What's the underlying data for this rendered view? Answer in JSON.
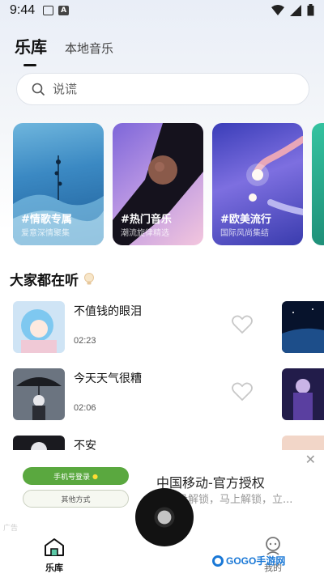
{
  "status_bar": {
    "time": "9:44"
  },
  "tabs": {
    "library": "乐库",
    "local_music": "本地音乐"
  },
  "search": {
    "placeholder": "说谎"
  },
  "categories": [
    {
      "title": "#情歌专属",
      "subtitle": "爱意深情聚集"
    },
    {
      "title": "#热门音乐",
      "subtitle": "潮流旋律精选"
    },
    {
      "title": "#欧美流行",
      "subtitle": "国际风尚集结"
    }
  ],
  "section": {
    "title": "大家都在听"
  },
  "songs": [
    {
      "name": "不值钱的眼泪",
      "duration": "02:23"
    },
    {
      "name": "今天天气很糟",
      "duration": "02:06"
    },
    {
      "name": "不安",
      "duration": ""
    }
  ],
  "ad": {
    "login_button": "手机号登录",
    "other_button": "其他方式",
    "title": "中国移动-官方授权",
    "description": "您还没解锁，马上解锁，立...",
    "label": "广告"
  },
  "nav": {
    "library": "乐库",
    "mine": "我的"
  },
  "watermark": {
    "text": "GOGO手游网"
  },
  "colors": {
    "accent_green": "#5aa83f",
    "heart_gray": "#c8c8c8"
  }
}
